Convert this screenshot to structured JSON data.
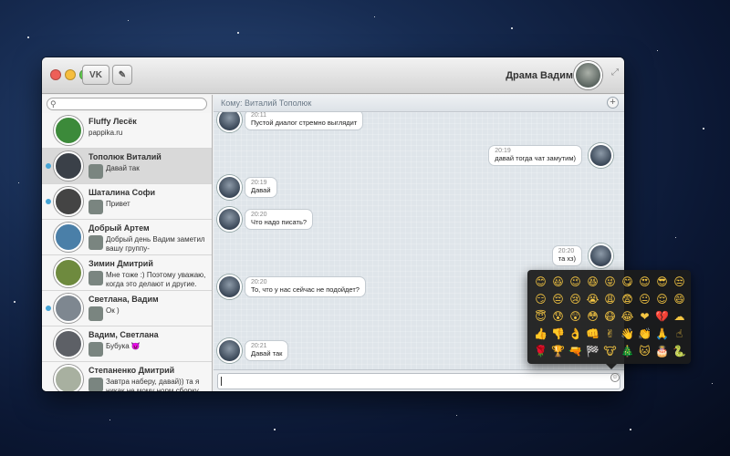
{
  "window": {
    "user_name": "Драма Вадим"
  },
  "icons": {
    "vk": "vk-logo-icon",
    "compose": "compose-icon",
    "expand": "expand-icon",
    "search": "search-icon",
    "add": "add-icon",
    "emoji": "emoji-icon"
  },
  "colors": {
    "online_dot": "#45a4d6",
    "bubble": "#ffffff",
    "chat_bg": "#dfe5ea"
  },
  "search": {
    "placeholder": ""
  },
  "contacts": [
    {
      "name": "Fluffy Лесёк",
      "preview": "pappika.ru",
      "online": false,
      "mini": false,
      "active": false,
      "avatar_color": "#3c8a3a"
    },
    {
      "name": "Тополюк Виталий",
      "preview": "Давай так",
      "online": true,
      "mini": true,
      "active": true,
      "avatar_color": "#3a4048"
    },
    {
      "name": "Шаталина Софи",
      "preview": "Привет",
      "online": true,
      "mini": true,
      "active": false,
      "avatar_color": "#444444"
    },
    {
      "name": "Добрый Артем",
      "preview": "Добрый день Вадим заметил вашу группу-",
      "online": false,
      "mini": true,
      "active": false,
      "avatar_color": "#4a7fa8"
    },
    {
      "name": "Зимин Дмитрий",
      "preview": "Мне тоже :) Поэтому уважаю, когда это делают и другие.",
      "online": false,
      "mini": true,
      "active": false,
      "avatar_color": "#6e8a3e"
    },
    {
      "name": "Светлана, Вадим",
      "preview": "Ок )",
      "online": true,
      "mini": true,
      "active": false,
      "avatar_color": "#7e8790"
    },
    {
      "name": "Вадим, Светлана",
      "preview": "Бубука 😈",
      "online": false,
      "mini": true,
      "active": false,
      "avatar_color": "#5d6066"
    },
    {
      "name": "Степаненко Дмитрий",
      "preview": "Завтра наберу, давай)) та я никак не мому норм сборку",
      "online": false,
      "mini": true,
      "active": false,
      "avatar_color": "#a8b0a0"
    }
  ],
  "chat": {
    "to_label": "Кому: Виталий Тополюк",
    "messages": [
      {
        "dir": "in",
        "time": "20:11",
        "text": "Пустой диалог стремно выглядит"
      },
      {
        "dir": "out",
        "time": "20:19",
        "text": "давай тогда чат замутим)"
      },
      {
        "dir": "in",
        "time": "20:19",
        "text": "Давай"
      },
      {
        "dir": "in",
        "time": "20:20",
        "text": "Что надо писать?"
      },
      {
        "dir": "out",
        "time": "20:20",
        "text": "та хз)"
      },
      {
        "dir": "in",
        "time": "20:20",
        "text": "То, что у нас сейчас не подойдет?"
      },
      {
        "dir": "in",
        "time": "20:21",
        "text": "Давай так"
      }
    ],
    "input_value": ""
  },
  "emoji_panel": {
    "emojis": [
      "😊",
      "😃",
      "😉",
      "😆",
      "😜",
      "😋",
      "😍",
      "😎",
      "😒",
      "😏",
      "😔",
      "😢",
      "😭",
      "😩",
      "😨",
      "😐",
      "😌",
      "😄",
      "😇",
      "😰",
      "😲",
      "😳",
      "😷",
      "😂",
      "❤",
      "💔",
      "☁",
      "👍",
      "👎",
      "👌",
      "👊",
      "✌",
      "👋",
      "👏",
      "🙏",
      "☝",
      "🌹",
      "🏆",
      "🔫",
      "🏁",
      "🐮",
      "🎄",
      "🐱",
      "🎂",
      "🐍"
    ]
  }
}
